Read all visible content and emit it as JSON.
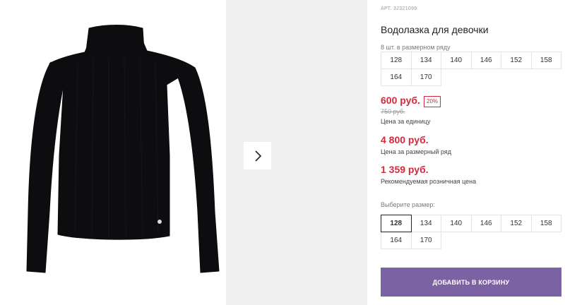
{
  "product": {
    "sku_label": "АРТ.",
    "sku": "32321099",
    "title": "Водолазка для девочки",
    "pack_label": "8 шт. в размерном ряду",
    "pack_sizes": [
      "128",
      "134",
      "140",
      "146",
      "152",
      "158",
      "164",
      "170"
    ]
  },
  "pricing": {
    "unit_price": "600 руб.",
    "discount": "20%",
    "old_price": "750 руб.",
    "unit_caption": "Цена за единицу",
    "pack_price": "4 800 руб.",
    "pack_caption": "Цена за размерный ряд",
    "retail_price": "1 359 руб.",
    "retail_caption": "Рекомендуемая розничная цена"
  },
  "size_picker": {
    "label": "Выберите размер:",
    "selected": "128",
    "sizes": [
      "128",
      "134",
      "140",
      "146",
      "152",
      "158",
      "164",
      "170"
    ]
  },
  "actions": {
    "add_to_cart": "ДОБАВИТЬ В КОРЗИНУ"
  },
  "icons": {
    "next": "chevron-right-icon",
    "product": "black-turtleneck-image"
  },
  "colors": {
    "price": "#d12a3b",
    "button": "#7b62a3",
    "garment": "#0d0d0f"
  }
}
